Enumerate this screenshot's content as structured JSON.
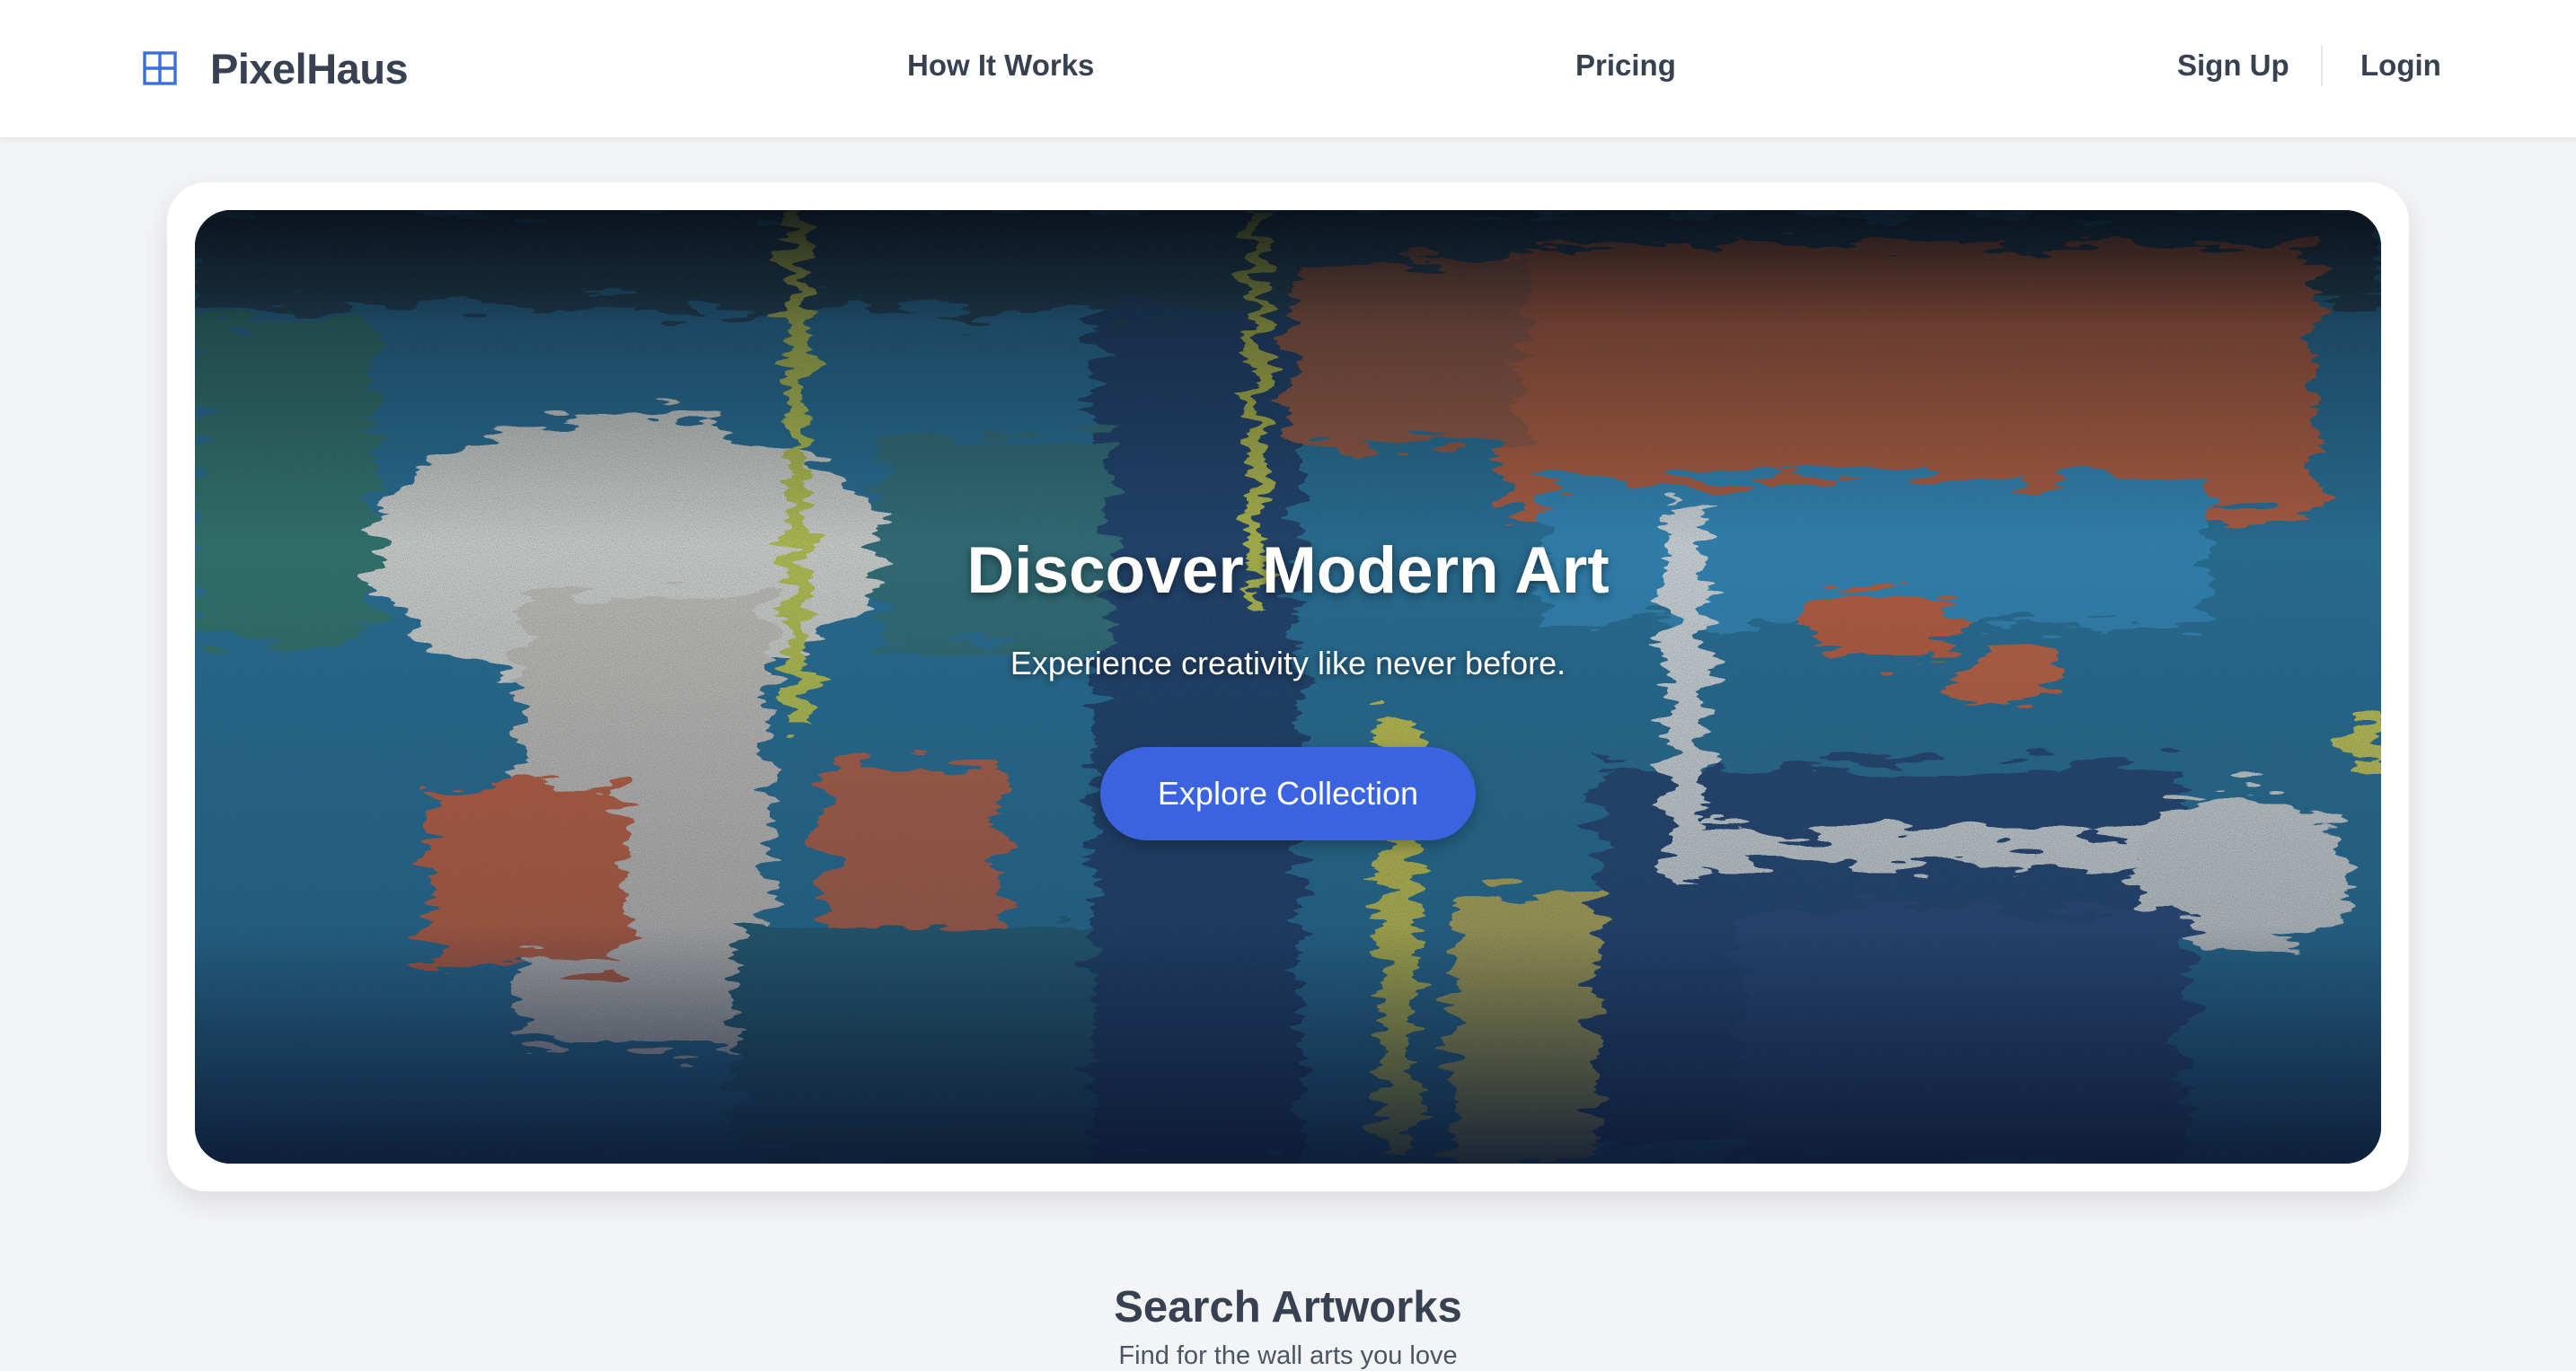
{
  "brand": {
    "name": "PixelHaus",
    "icon": "grid-icon",
    "accent": "#3b6fd8"
  },
  "nav": {
    "how_it_works": "How It Works",
    "pricing": "Pricing",
    "sign_up": "Sign Up",
    "login": "Login"
  },
  "hero": {
    "title": "Discover Modern Art",
    "subtitle": "Experience creativity like never before.",
    "cta_label": "Explore Collection",
    "cta_color": "#3b63e0"
  },
  "search_section": {
    "title": "Search Artworks",
    "subtitle": "Find for the wall arts you love"
  }
}
